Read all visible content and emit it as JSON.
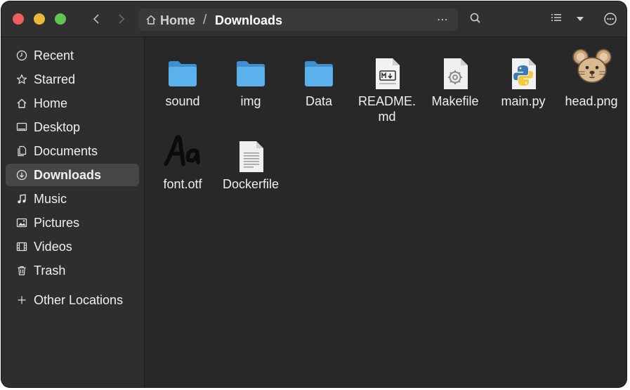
{
  "toolbar": {
    "path_home": "Home",
    "path_separator": "/",
    "path_current": "Downloads",
    "path_more": "⋯"
  },
  "sidebar": {
    "items": [
      {
        "label": "Recent",
        "icon": "clock-icon"
      },
      {
        "label": "Starred",
        "icon": "star-icon"
      },
      {
        "label": "Home",
        "icon": "home-icon"
      },
      {
        "label": "Desktop",
        "icon": "desktop-icon"
      },
      {
        "label": "Documents",
        "icon": "documents-icon"
      },
      {
        "label": "Downloads",
        "icon": "download-icon",
        "active": true
      },
      {
        "label": "Music",
        "icon": "music-icon"
      },
      {
        "label": "Pictures",
        "icon": "pictures-icon"
      },
      {
        "label": "Videos",
        "icon": "videos-icon"
      },
      {
        "label": "Trash",
        "icon": "trash-icon"
      }
    ],
    "other_locations": "Other Locations"
  },
  "files": [
    {
      "name": "sound",
      "icon": "folder-icon"
    },
    {
      "name": "img",
      "icon": "folder-icon"
    },
    {
      "name": "Data",
      "icon": "folder-icon"
    },
    {
      "name": "README.md",
      "icon": "markdown-file-icon"
    },
    {
      "name": "Makefile",
      "icon": "makefile-icon"
    },
    {
      "name": "main.py",
      "icon": "python-file-icon"
    },
    {
      "name": "head.png",
      "icon": "mouse-image-icon"
    },
    {
      "name": "font.otf",
      "icon": "font-file-icon"
    },
    {
      "name": "Dockerfile",
      "icon": "text-file-icon"
    }
  ],
  "colors": {
    "window_bg": "#2a2a2a",
    "sidebar_active": "#464646",
    "folder_blue": "#5bb1ec",
    "close": "#ec5f5d",
    "minimize": "#e8b73c",
    "maximize": "#61c454"
  }
}
